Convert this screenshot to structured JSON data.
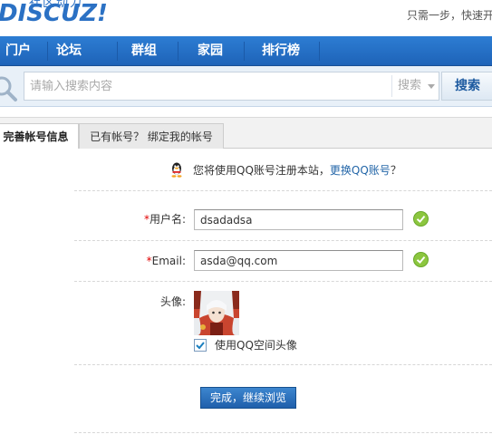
{
  "header": {
    "logo_text": "DISCUZ!",
    "logo_subtext": "社区动力",
    "topright_text": "只需一步，快速开"
  },
  "nav": {
    "items": [
      "门户",
      "论坛",
      "群组",
      "家园",
      "排行榜"
    ]
  },
  "search": {
    "placeholder": "请输入搜索内容",
    "type_label": "搜索",
    "button_label": "搜索"
  },
  "tabs": [
    {
      "label": "完善帐号信息",
      "active": true
    },
    {
      "label": "已有帐号？ 绑定我的帐号",
      "active": false
    }
  ],
  "notice": {
    "text": "您将使用QQ账号注册本站，",
    "link": "更换QQ账号",
    "suffix": "？"
  },
  "form": {
    "username_label": "用户名:",
    "username_value": "dsadadsa",
    "email_label": "Email:",
    "email_value": "asda@qq.com",
    "avatar_label": "头像:",
    "use_qq_avatar_label": "使用QQ空间头像",
    "use_qq_avatar_checked": true,
    "required_mark": "*",
    "submit_label": "完成，继续浏览"
  },
  "colors": {
    "nav_blue": "#2d7dd3",
    "link_blue": "#2366a8",
    "required_red": "#e10000",
    "ok_green": "#8cc63f"
  }
}
